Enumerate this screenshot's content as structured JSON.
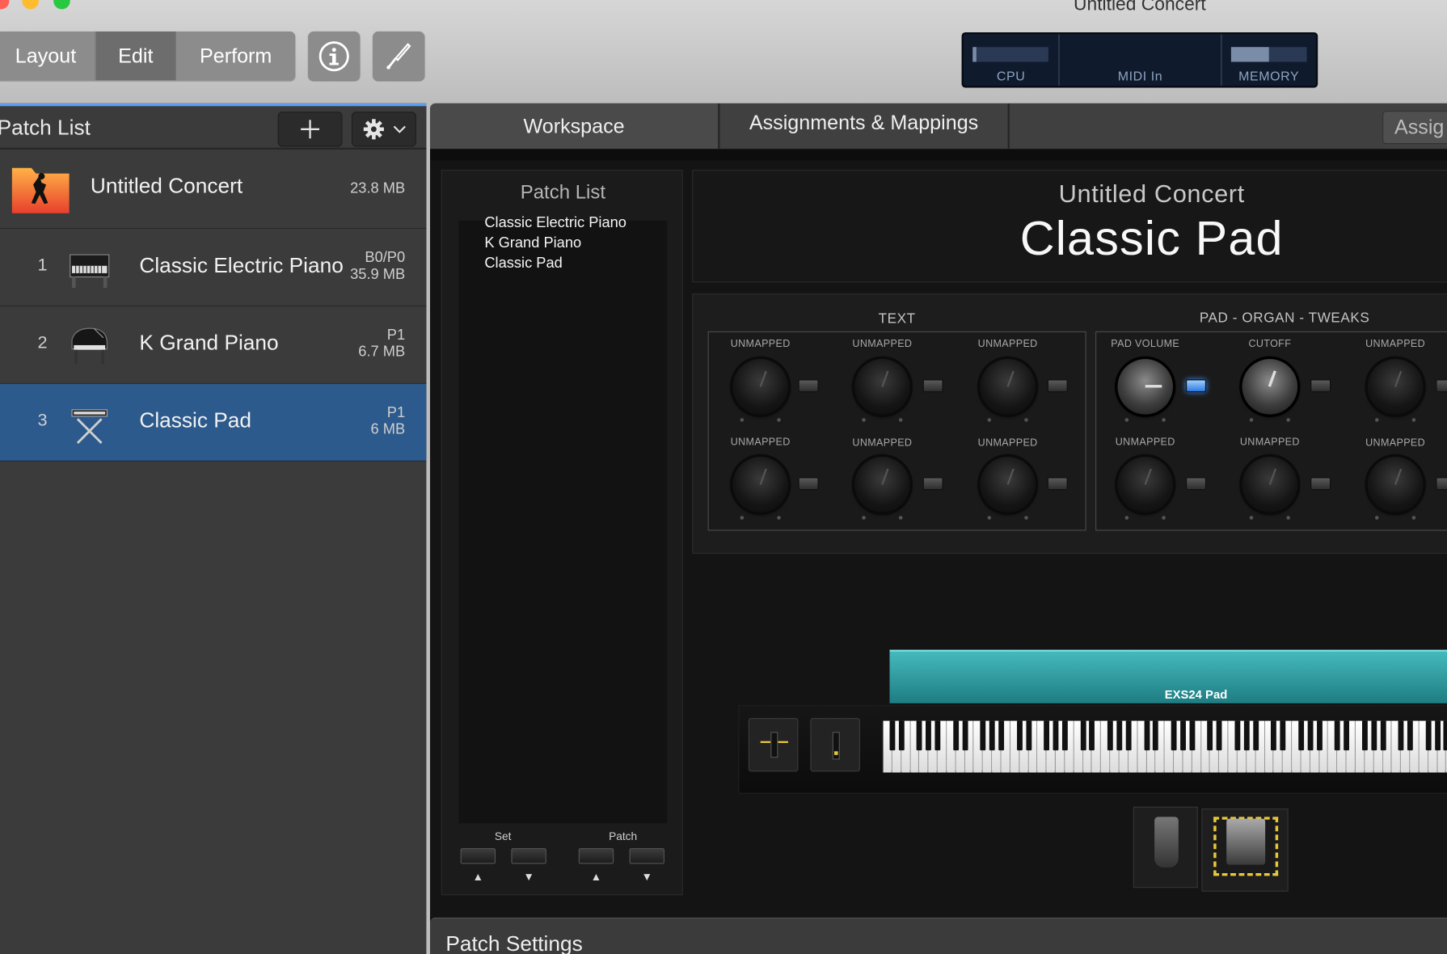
{
  "window": {
    "title": "Untitled Concert"
  },
  "toolbar": {
    "modes": [
      "Layout",
      "Edit",
      "Perform"
    ],
    "selected_mode": "Edit",
    "info_icon": "info-icon",
    "tuner_icon": "tuning-fork-icon"
  },
  "meters": {
    "cpu_label": "CPU",
    "midi_label": "MIDI In",
    "memory_label": "MEMORY",
    "cpu_level": 0.05,
    "memory_level": 0.5
  },
  "patch_list": {
    "title": "Patch List",
    "add_icon": "plus-icon",
    "settings_icon": "gear-icon",
    "concert": {
      "name": "Untitled Concert",
      "size": "23.8 MB"
    },
    "patches": [
      {
        "number": "1",
        "name": "Classic Electric Piano",
        "bank": "B0/P0",
        "size": "35.9 MB",
        "icon": "electric-piano-icon",
        "selected": false
      },
      {
        "number": "2",
        "name": "K Grand Piano",
        "bank": "P1",
        "size": "6.7 MB",
        "icon": "grand-piano-icon",
        "selected": false
      },
      {
        "number": "3",
        "name": "Classic Pad",
        "bank": "P1",
        "size": "6 MB",
        "icon": "keyboard-stand-icon",
        "selected": true
      }
    ]
  },
  "tabs": [
    "Workspace",
    "Assignments & Mappings",
    "Assig"
  ],
  "workspace": {
    "patch_list_panel": {
      "title": "Patch List",
      "items": [
        "Classic Electric Piano",
        "K Grand Piano",
        "Classic Pad"
      ],
      "set_label": "Set",
      "patch_label": "Patch",
      "up_arrow": "▲",
      "down_arrow": "▼"
    },
    "display": {
      "concert": "Untitled Concert",
      "patch": "Classic Pad"
    },
    "groups": [
      {
        "title": "TEXT",
        "knobs": [
          "UNMAPPED",
          "UNMAPPED",
          "UNMAPPED",
          "UNMAPPED",
          "UNMAPPED",
          "UNMAPPED"
        ]
      },
      {
        "title": "PAD - ORGAN - TWEAKS",
        "knobs": [
          "PAD VOLUME",
          "CUTOFF",
          "UNMAPPED",
          "UNMAPPED",
          "UNMAPPED",
          "UNMAPPED"
        ]
      }
    ],
    "layer_name": "EXS24 Pad"
  },
  "patch_settings": {
    "label": "Patch Settings"
  },
  "colors": {
    "selection": "#2c5a8c",
    "accent_blue": "#5d9ef0",
    "layer_teal": "#2aa3a8",
    "led_on": "#3d8fff"
  }
}
